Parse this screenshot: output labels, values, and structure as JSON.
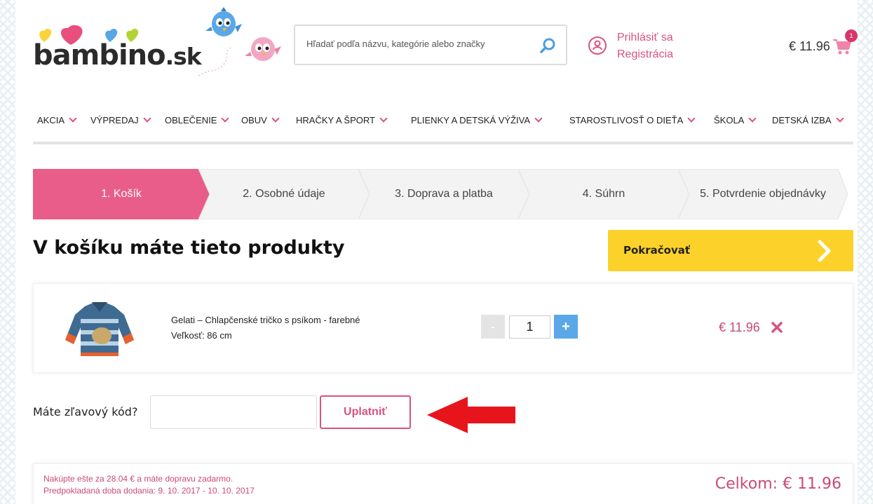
{
  "brand": {
    "name": "bambino",
    "tld": ".sk"
  },
  "search": {
    "placeholder": "Hľadať podľa názvu, kategórie alebo značky"
  },
  "account": {
    "login_label": "Prihlásiť sa",
    "register_label": "Registrácia"
  },
  "cart": {
    "total": "€ 11.96",
    "count": "1"
  },
  "nav": {
    "items": [
      {
        "label": "AKCIA"
      },
      {
        "label": "VÝPREDAJ"
      },
      {
        "label": "OBLEČENIE"
      },
      {
        "label": "OBUV"
      },
      {
        "label": "HRAČKY A ŠPORT"
      },
      {
        "label": "PLIENKY A DETSKÁ VÝŽIVA"
      },
      {
        "label": "STAROSTLIVOSŤ O DIEŤA"
      },
      {
        "label": "ŠKOLA"
      },
      {
        "label": "DETSKÁ IZBA"
      }
    ]
  },
  "steps": [
    {
      "label": "1. Košík",
      "active": true
    },
    {
      "label": "2. Osobné údaje",
      "active": false
    },
    {
      "label": "3. Doprava a platba",
      "active": false
    },
    {
      "label": "4. Súhrn",
      "active": false
    },
    {
      "label": "5. Potvrdenie objednávky",
      "active": false
    }
  ],
  "main": {
    "title": "V košíku máte tieto produkty",
    "continue_label": "Pokračovať"
  },
  "item": {
    "name": "Gelati – Chlapčenské tričko s psíkom - farebné",
    "size": "Veľkosť: 86 cm",
    "quantity": "1",
    "minus_label": "-",
    "plus_label": "+",
    "price": "€ 11.96"
  },
  "discount": {
    "label": "Máte zľavový kód?",
    "value": "",
    "apply_label": "Uplatniť"
  },
  "summary": {
    "free_shipping_note": "Nakúpte ešte za 28.04 € a máte dopravu zadarmo.",
    "delivery_estimate": "Predpokladaná doba dodania: 9. 10. 2017 - 10. 10. 2017",
    "total": "Celkom: € 11.96"
  },
  "colors": {
    "brand_pink": "#d9527f",
    "step_active": "#e85d8a",
    "continue_yellow": "#fcd22a",
    "plus_blue": "#5aa8e8",
    "annotation_red": "#e8141b"
  }
}
